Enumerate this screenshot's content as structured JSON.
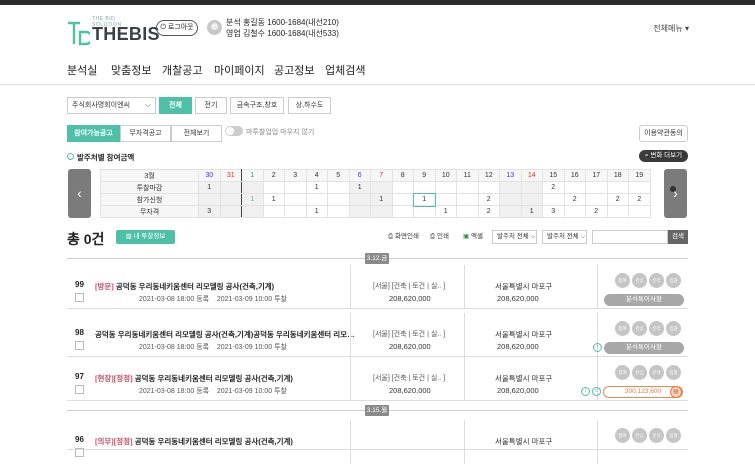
{
  "header": {
    "logo_text": "THEBIS",
    "logo_sub": "THE BID SOLUTION",
    "logout_label": "로그아웃",
    "contact_1": "분석 홍길동 1600-1684(내선210)",
    "contact_2": "영업 김철수 1600-1684(내선533)",
    "all_menu_label": "전체메뉴"
  },
  "nav": {
    "items": [
      "분석실",
      "맞춤정보",
      "개찰공고",
      "마이페이지",
      "공고정보",
      "업체검색"
    ]
  },
  "filters": {
    "company_select": "주식회사명회이엔씨",
    "buttons": [
      "전체",
      "전기",
      "금속구조,창호",
      "상,하수도"
    ]
  },
  "tabs": {
    "items": [
      "참여가능공고",
      "무자격공고",
      "전체보기"
    ]
  },
  "toggle_label": "마투찰업업 마우지 않기",
  "terms_button": "이용약관동의",
  "section_title": "발주처별 참여금액",
  "more_button": "변화 더보기",
  "calendar": {
    "month_label": "3월",
    "days": [
      "30",
      "31",
      "1",
      "2",
      "3",
      "4",
      "5",
      "6",
      "7",
      "8",
      "9",
      "10",
      "11",
      "12",
      "13",
      "14",
      "15",
      "16",
      "17",
      "18",
      "19"
    ],
    "day_colors": [
      "#3a3ac8",
      "#c83a3a",
      "#3a9a6a",
      "#333",
      "#333",
      "#333",
      "#333",
      "#3a3ac8",
      "#c83a3a",
      "#333",
      "#333",
      "#333",
      "#333",
      "#333",
      "#3a3ac8",
      "#c83a3a",
      "#333",
      "#333",
      "#333",
      "#333",
      "#333"
    ],
    "rows": [
      {
        "label": "투찰마감",
        "cells": [
          "1",
          "",
          "",
          "",
          "",
          "1",
          "",
          "1",
          "",
          "",
          "",
          "",
          "",
          "",
          "",
          "",
          "2",
          "",
          "",
          "",
          ""
        ]
      },
      {
        "label": "참가신청",
        "cells": [
          "",
          "",
          "1",
          "1",
          "",
          "",
          "",
          "",
          "1",
          "",
          "1",
          "",
          "",
          "2",
          "",
          "",
          "",
          "2",
          "",
          "2",
          "2"
        ]
      },
      {
        "label": "무자격",
        "cells": [
          "3",
          "",
          "",
          "",
          "",
          "1",
          "",
          "",
          "",
          "",
          "",
          "1",
          "",
          "2",
          "",
          "1",
          "3",
          "",
          "2",
          "",
          ""
        ]
      }
    ]
  },
  "list": {
    "total_label": "총 0건",
    "bid_info_button": "내 투찰정보",
    "print_screen": "화면인쇄",
    "print": "인쇄",
    "excel": "엑셀",
    "dropdown_1": "발주처 전체",
    "dropdown_2": "발주처 전체",
    "search_button": "검색",
    "date_group_1": "3.12.금",
    "date_group_2": "3.15.월",
    "rows": [
      {
        "num": "99",
        "tag1": "[방문]",
        "tag2": "",
        "title": "공덕동 우리동네키움센터 리모델링 공사(건축,기계)",
        "reg": "2021-03-08 18:00 등록",
        "bid": "2021-03-09 10:00 투찰",
        "cat": "[서울] [건축 | 토건 | 실.. ]",
        "amount": "208,620,000",
        "loc": "서울특별시 마포구",
        "amount2": "208,620,000",
        "action": "분석특이사항"
      },
      {
        "num": "98",
        "tag1": "",
        "tag2": "",
        "title": "공덕동 우리동네키움센터 리모델링 공사(건축,기계)공덕동 우리동네키움센터 리모…",
        "reg": "2021-03-08 18:00 등록",
        "bid": "2021-03-09 10:00 투찰",
        "cat": "[서울] [건축 | 토건 | 실.. ]",
        "amount": "208,620,000",
        "loc": "서울특별시 마포구",
        "amount2": "208,620,000",
        "action": "분석특이사항"
      },
      {
        "num": "97",
        "tag1": "[현장]",
        "tag2": "[정정]",
        "title": "공덕동 우리동네키움센터 리모델링 공사(건축,기계)",
        "reg": "2021-03-08 18:00 등록",
        "bid": "2021-03-09 10:00 투찰",
        "cat": "[서울] [건축 | 토건 | 실.. ]",
        "amount": "208,620,000",
        "loc": "서울특별시 마포구",
        "amount2": "208,620,000",
        "action": "300,123,600"
      },
      {
        "num": "96",
        "tag1": "[의무]",
        "tag2": "[정정]",
        "title": "공덕동 우리동네키움센터 리모델링 공사(건축,기계)",
        "reg": "",
        "bid": "",
        "cat": "",
        "amount": "",
        "loc": "서울특별시 마포구",
        "amount2": "",
        "action": ""
      }
    ],
    "circle_labels": [
      "참여",
      "관심",
      "분석",
      "입찰"
    ]
  },
  "colors": {
    "accent": "#4ec0a8",
    "dark": "#2b2b2b",
    "orange": "#e07a40"
  }
}
